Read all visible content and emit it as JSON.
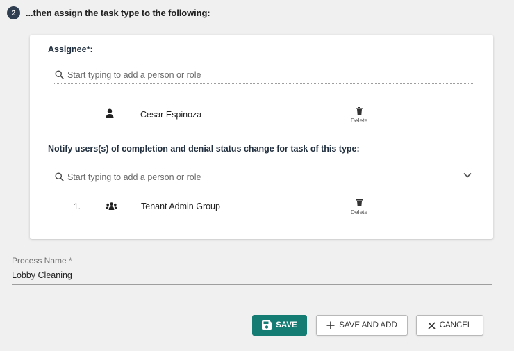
{
  "step": {
    "number": "2",
    "title": "...then assign the task type to the following:"
  },
  "assignee": {
    "label": "Assignee*:",
    "search_placeholder": "Start typing to add a person or role",
    "items": [
      {
        "name": "Cesar Espinoza",
        "icon": "person-icon",
        "delete_label": "Delete"
      }
    ]
  },
  "notify": {
    "label": "Notify users(s) of completion and denial status change for task of this type:",
    "search_placeholder": "Start typing to add a person or role",
    "items": [
      {
        "index": "1.",
        "name": "Tenant Admin Group",
        "icon": "group-icon",
        "delete_label": "Delete"
      }
    ]
  },
  "process": {
    "label": "Process Name *",
    "value": "Lobby Cleaning"
  },
  "actions": {
    "save": "SAVE",
    "save_and_add": "SAVE AND ADD",
    "cancel": "CANCEL"
  },
  "colors": {
    "primary": "#157c74",
    "step_badge": "#2f3e50"
  }
}
